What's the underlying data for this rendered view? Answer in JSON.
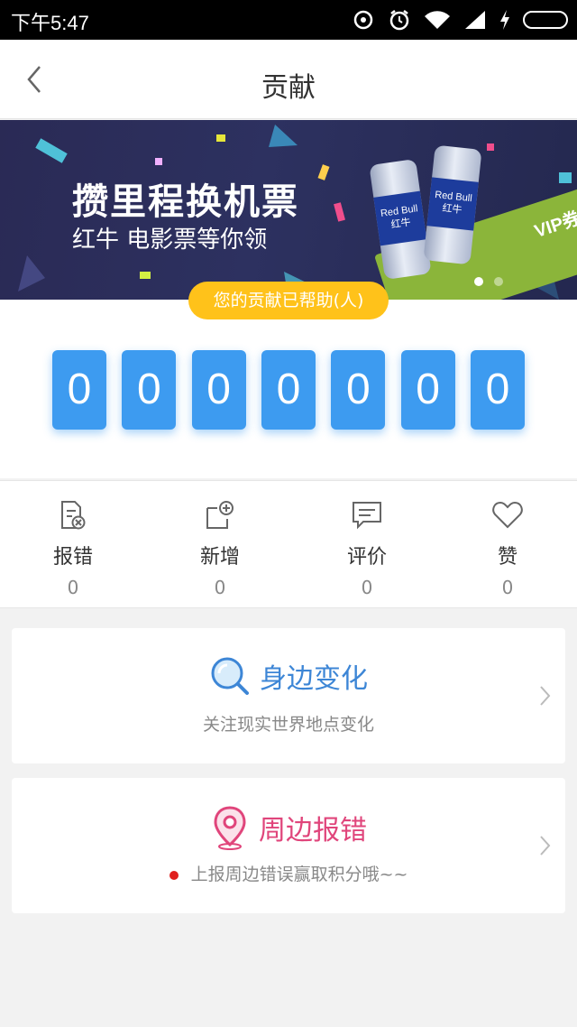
{
  "status_bar": {
    "time": "下午5:47",
    "icons": [
      "sync-icon",
      "alarm-icon",
      "wifi-icon",
      "signal-icon",
      "charging-icon",
      "battery-icon"
    ]
  },
  "nav": {
    "title": "贡献",
    "back_icon": "chevron-left-icon"
  },
  "banner": {
    "headline": "攒里程换机票",
    "subtitle": "红牛 电影票等你领",
    "can_label": "Red Bull\n红牛",
    "ticket_text": "VIP券",
    "slide_count": 2,
    "active_slide": 0
  },
  "counter": {
    "label": "您的贡献已帮助(人)",
    "digits": [
      "0",
      "0",
      "0",
      "0",
      "0",
      "0",
      "0"
    ],
    "accent": "#3d9bf0",
    "pill_color": "#ffc21a"
  },
  "stats": [
    {
      "label": "报错",
      "value": "0",
      "icon": "report-error-icon"
    },
    {
      "label": "新增",
      "value": "0",
      "icon": "add-place-icon"
    },
    {
      "label": "评价",
      "value": "0",
      "icon": "comment-icon"
    },
    {
      "label": "赞",
      "value": "0",
      "icon": "heart-icon"
    }
  ],
  "cards": [
    {
      "title": "身边变化",
      "subtitle": "关注现实世界地点变化",
      "icon": "search-icon",
      "color": "#3d86d6"
    },
    {
      "title": "周边报错",
      "subtitle": "上报周边错误赢取积分哦~~",
      "icon": "location-pin-icon",
      "color": "#e0457b"
    }
  ]
}
